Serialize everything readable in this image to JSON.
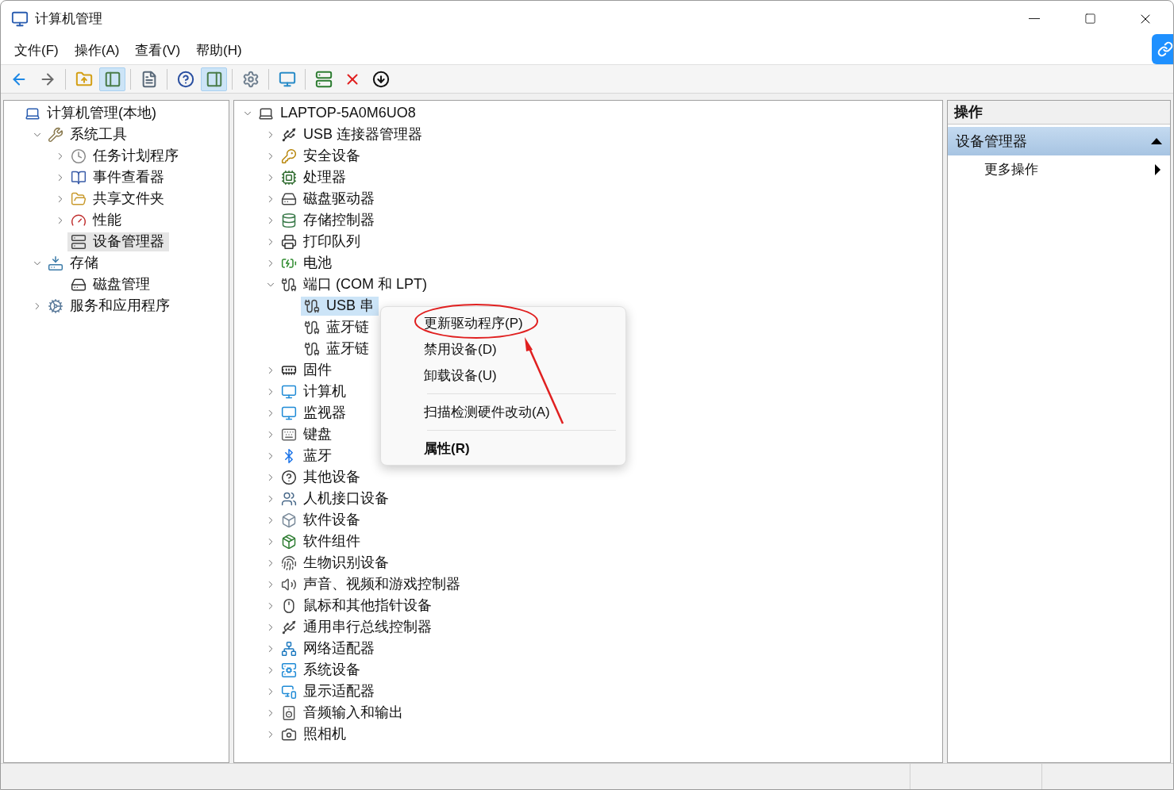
{
  "window": {
    "title": "计算机管理"
  },
  "menu_bar": [
    {
      "label": "文件(F)"
    },
    {
      "label": "操作(A)"
    },
    {
      "label": "查看(V)"
    },
    {
      "label": "帮助(H)"
    }
  ],
  "toolbar": [
    {
      "kind": "back",
      "selected": false
    },
    {
      "kind": "forward",
      "selected": false
    },
    {
      "kind": "sep"
    },
    {
      "kind": "up",
      "selected": false
    },
    {
      "kind": "tree",
      "selected": true
    },
    {
      "kind": "sep"
    },
    {
      "kind": "props",
      "selected": false
    },
    {
      "kind": "sep"
    },
    {
      "kind": "help",
      "selected": false
    },
    {
      "kind": "pane",
      "selected": true
    },
    {
      "kind": "sep"
    },
    {
      "kind": "scan",
      "selected": false
    },
    {
      "kind": "sep"
    },
    {
      "kind": "monitor",
      "selected": false
    },
    {
      "kind": "sep"
    },
    {
      "kind": "update",
      "selected": false
    },
    {
      "kind": "remove",
      "selected": false
    },
    {
      "kind": "down",
      "selected": false
    }
  ],
  "nav_tree": [
    {
      "label": "计算机管理(本地)",
      "selected": false,
      "children": [
        {
          "label": "系统工具",
          "expanded": true,
          "selected": false,
          "children": [
            {
              "label": "任务计划程序",
              "expanded": false,
              "selected": false
            },
            {
              "label": "事件查看器",
              "expanded": false,
              "selected": false
            },
            {
              "label": "共享文件夹",
              "expanded": false,
              "selected": false
            },
            {
              "label": "性能",
              "expanded": false,
              "selected": false
            },
            {
              "label": "设备管理器",
              "selected": true
            }
          ]
        },
        {
          "label": "存储",
          "expanded": true,
          "selected": false,
          "children": [
            {
              "label": "磁盘管理",
              "selected": false
            }
          ]
        },
        {
          "label": "服务和应用程序",
          "expanded": false,
          "selected": false
        }
      ]
    }
  ],
  "device_tree": [
    {
      "label": "LAPTOP-5A0M6UO8",
      "expanded": true,
      "selected": false,
      "children": [
        {
          "label": "USB 连接器管理器",
          "expanded": false,
          "selected": false
        },
        {
          "label": "安全设备",
          "expanded": false,
          "selected": false
        },
        {
          "label": "处理器",
          "expanded": false,
          "selected": false
        },
        {
          "label": "磁盘驱动器",
          "expanded": false,
          "selected": false
        },
        {
          "label": "存储控制器",
          "expanded": false,
          "selected": false
        },
        {
          "label": "打印队列",
          "expanded": false,
          "selected": false
        },
        {
          "label": "电池",
          "expanded": false,
          "selected": false
        },
        {
          "label": "端口 (COM 和 LPT)",
          "expanded": true,
          "selected": false,
          "children": [
            {
              "label": "USB 串",
              "selected": true
            },
            {
              "label": "蓝牙链",
              "selected": false
            },
            {
              "label": "蓝牙链",
              "selected": false
            }
          ]
        },
        {
          "label": "固件",
          "expanded": false,
          "selected": false
        },
        {
          "label": "计算机",
          "expanded": false,
          "selected": false
        },
        {
          "label": "监视器",
          "expanded": false,
          "selected": false
        },
        {
          "label": "键盘",
          "expanded": false,
          "selected": false
        },
        {
          "label": "蓝牙",
          "expanded": false,
          "selected": false
        },
        {
          "label": "其他设备",
          "expanded": false,
          "selected": false
        },
        {
          "label": "人机接口设备",
          "expanded": false,
          "selected": false
        },
        {
          "label": "软件设备",
          "expanded": false,
          "selected": false
        },
        {
          "label": "软件组件",
          "expanded": false,
          "selected": false
        },
        {
          "label": "生物识别设备",
          "expanded": false,
          "selected": false
        },
        {
          "label": "声音、视频和游戏控制器",
          "expanded": false,
          "selected": false
        },
        {
          "label": "鼠标和其他指针设备",
          "expanded": false,
          "selected": false
        },
        {
          "label": "通用串行总线控制器",
          "expanded": false,
          "selected": false
        },
        {
          "label": "网络适配器",
          "expanded": false,
          "selected": false
        },
        {
          "label": "系统设备",
          "expanded": false,
          "selected": false
        },
        {
          "label": "显示适配器",
          "expanded": false,
          "selected": false
        },
        {
          "label": "音频输入和输出",
          "expanded": false,
          "selected": false
        },
        {
          "label": "照相机",
          "expanded": false,
          "selected": false
        }
      ]
    }
  ],
  "context_menu": [
    {
      "kind": "item",
      "label": "更新驱动程序(P)",
      "default": false
    },
    {
      "kind": "item",
      "label": "禁用设备(D)",
      "default": false
    },
    {
      "kind": "item",
      "label": "卸载设备(U)",
      "default": false
    },
    {
      "kind": "separator"
    },
    {
      "kind": "item",
      "label": "扫描检测硬件改动(A)",
      "default": false
    },
    {
      "kind": "separator"
    },
    {
      "kind": "item",
      "label": "属性(R)",
      "default": true
    }
  ],
  "actions_pane": {
    "title": "操作",
    "sections": [
      {
        "label": "设备管理器",
        "expanded": true,
        "items": [
          {
            "label": "更多操作"
          }
        ]
      }
    ]
  }
}
